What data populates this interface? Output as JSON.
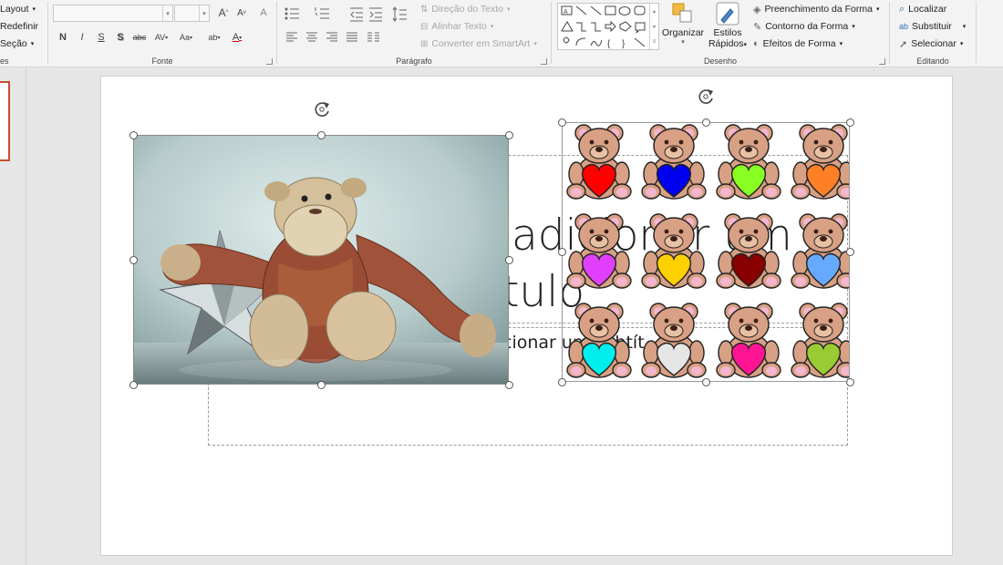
{
  "ribbon": {
    "slides": {
      "layout": "Layout",
      "reset": "Redefinir",
      "section": "Seção"
    },
    "font": {
      "group_label": "Fonte",
      "font_name_value": "",
      "font_size_value": "",
      "grow": "A",
      "shrink": "A",
      "clear_format": "A",
      "bold": "N",
      "italic": "I",
      "underline": "S",
      "shadow": "S",
      "strike": "abc",
      "spacing": "AV",
      "case": "Aa",
      "highlight": "ab",
      "color": "A"
    },
    "paragraph": {
      "group_label": "Parágrafo",
      "text_direction": "Direção do Texto",
      "align_text": "Alinhar Texto",
      "smartart": "Converter em SmartArt"
    },
    "drawing": {
      "group_label": "Desenho",
      "arrange": "Organizar",
      "quick_styles_1": "Estilos",
      "quick_styles_2": "Rápidos",
      "shape_fill": "Preenchimento da Forma",
      "shape_outline": "Contorno da Forma",
      "shape_effects": "Efeitos de Forma"
    },
    "editing": {
      "group_label": "Editando",
      "find": "Localizar",
      "replace": "Substituir",
      "select": "Selecionar"
    }
  },
  "slide": {
    "title_line1": "adicionar um",
    "title_line2": "tulo",
    "subtitle": "cionar um subtít"
  },
  "bears": {
    "heart_colors": [
      "#ff0000",
      "#0000ee",
      "#88ff22",
      "#ff7f27",
      "#e040fb",
      "#ffd000",
      "#880000",
      "#66aaff",
      "#00eeee",
      "#e6e6e6",
      "#ff1493",
      "#99cc33"
    ]
  },
  "colors": {
    "accent": "#c4502f",
    "handle_stroke": "#555555"
  }
}
